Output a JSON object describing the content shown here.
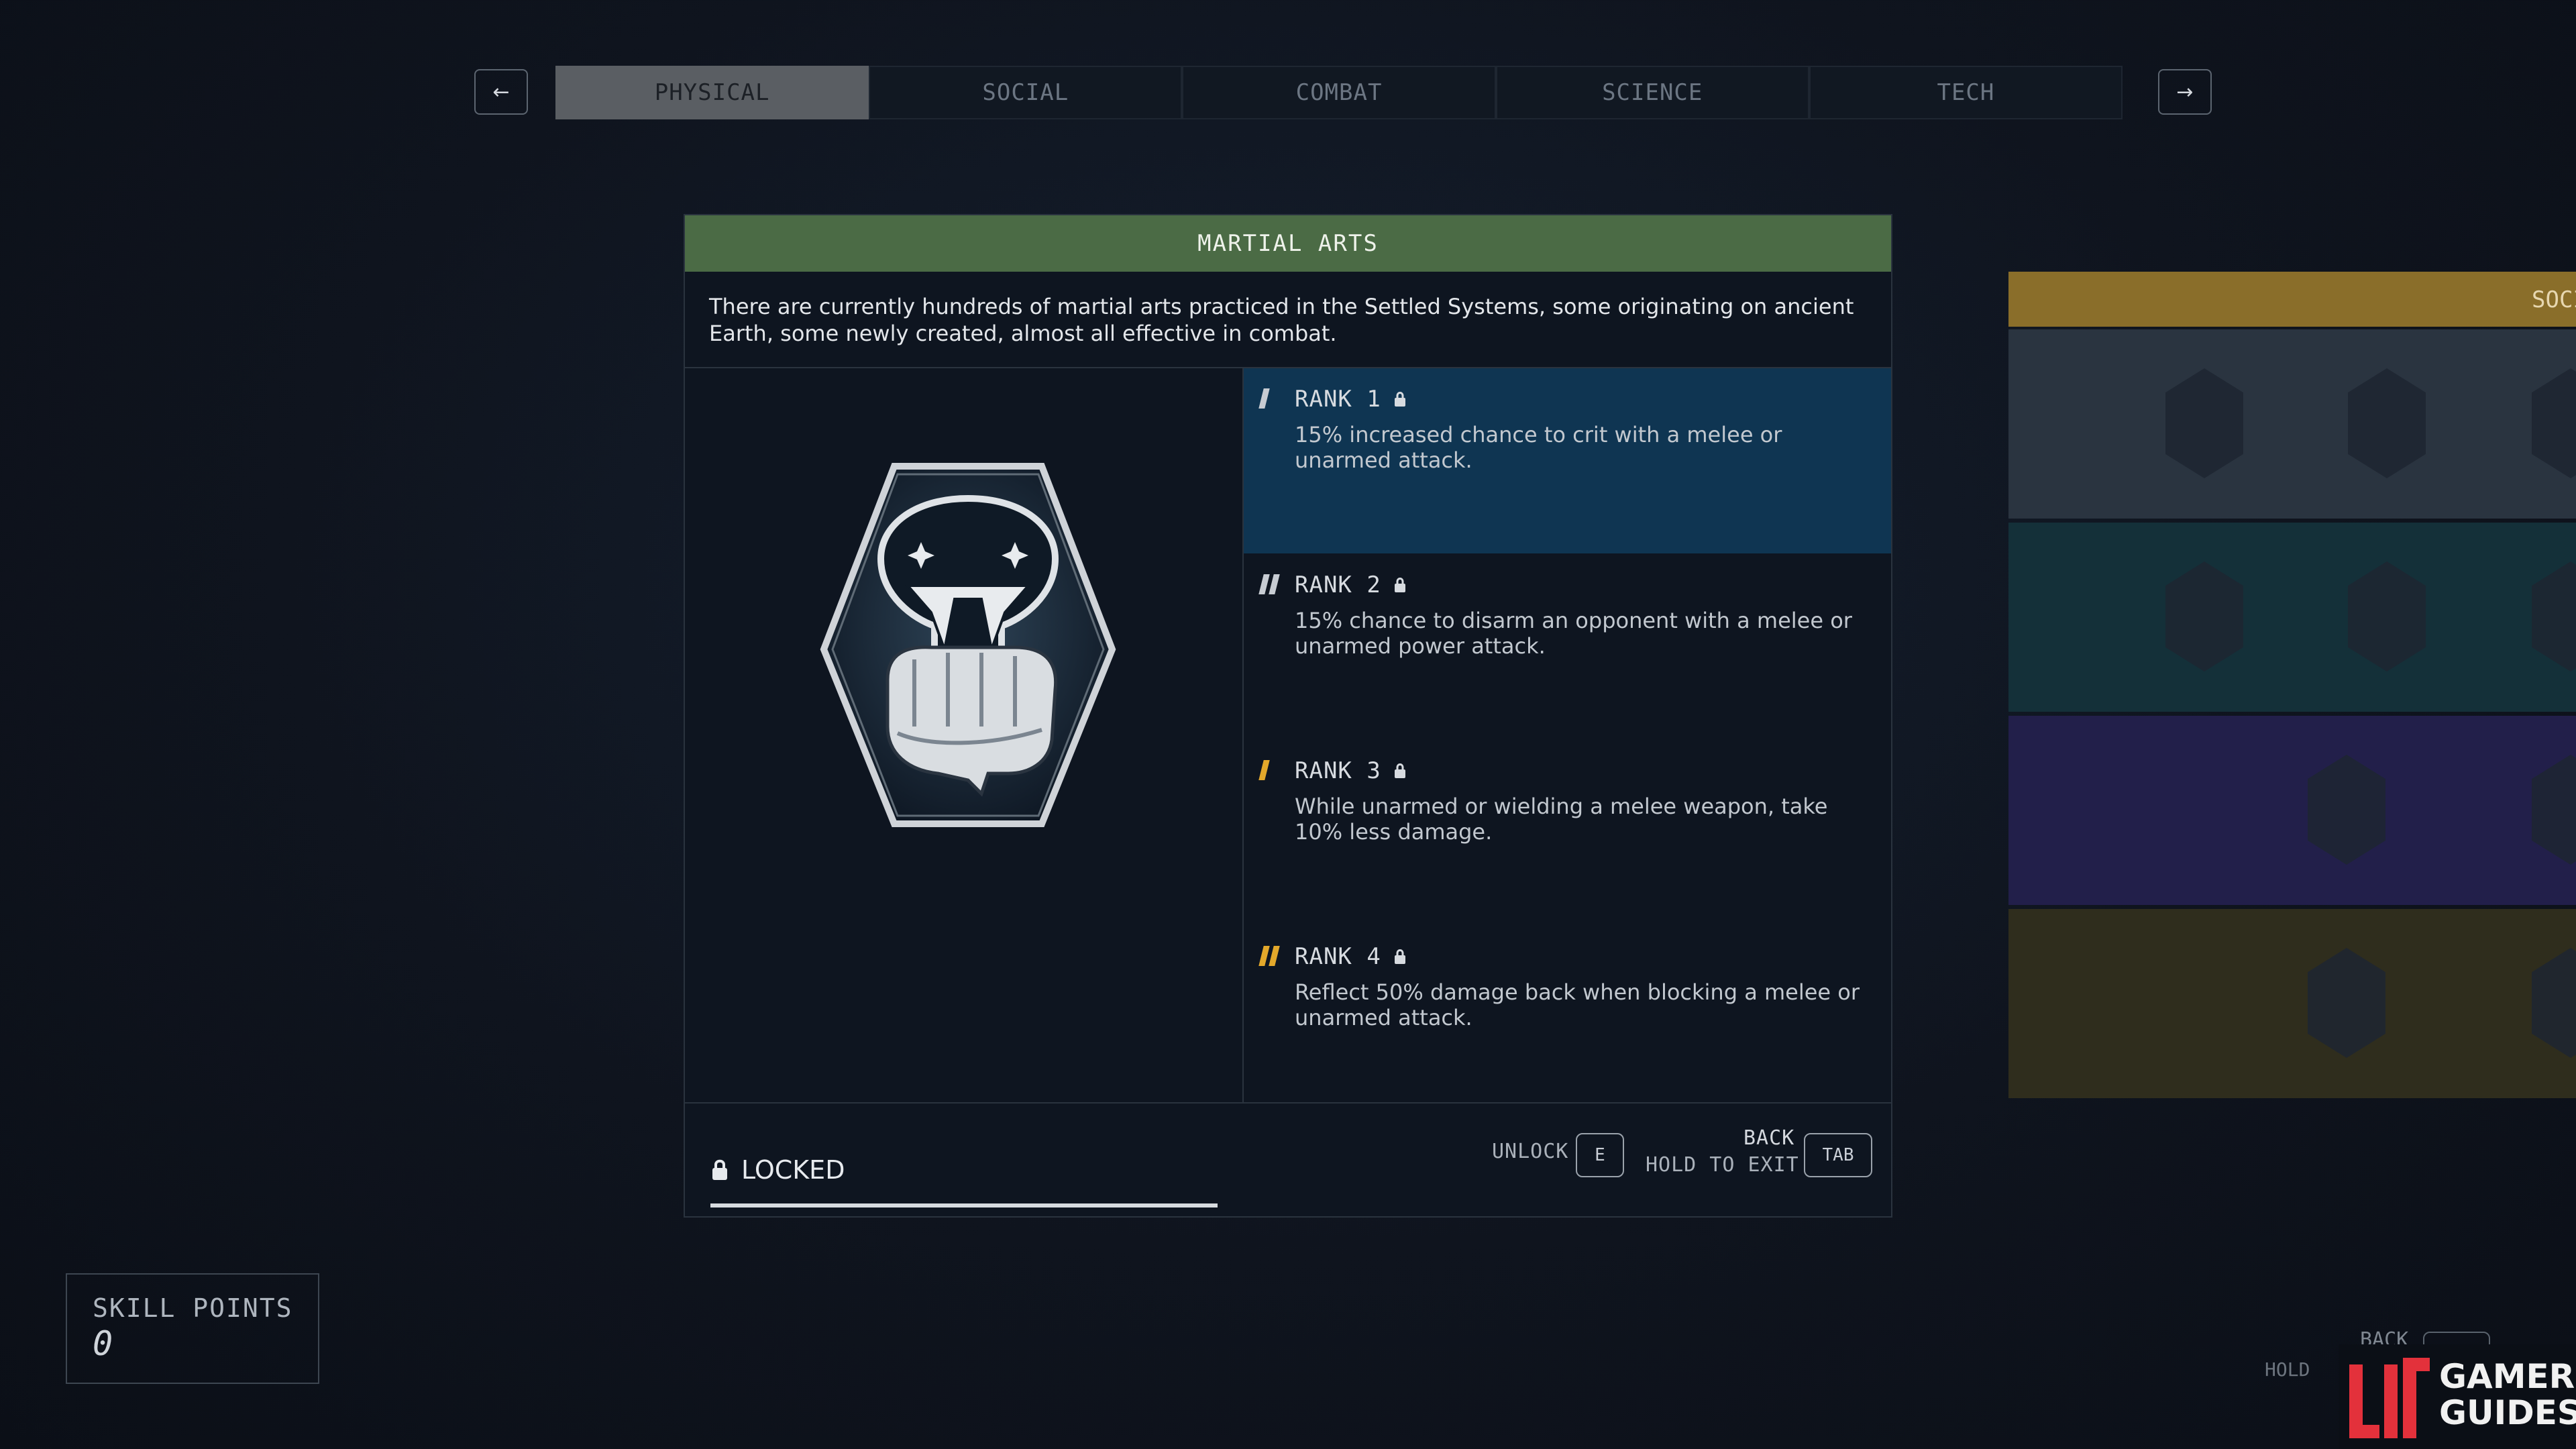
{
  "nav": {
    "prev_icon": "arrow-left-icon",
    "prev_glyph": "←",
    "next_icon": "arrow-right-icon",
    "next_glyph": "→",
    "tabs": [
      {
        "label": "PHYSICAL",
        "active": true
      },
      {
        "label": "SOCIAL",
        "active": false
      },
      {
        "label": "COMBAT",
        "active": false
      },
      {
        "label": "SCIENCE",
        "active": false
      },
      {
        "label": "TECH",
        "active": false
      }
    ]
  },
  "skill": {
    "title": "MARTIAL ARTS",
    "description": "There are currently hundreds of martial arts practiced in the Settled Systems, some originating on ancient Earth, some newly created, almost all effective in combat.",
    "badge_icon": "snake-fist-badge-icon",
    "status": "LOCKED",
    "ranks": [
      {
        "label": "RANK 1",
        "text": "15% increased chance to crit with a melee or unarmed attack.",
        "marks": 1,
        "selected": true
      },
      {
        "label": "RANK 2",
        "text": "15% chance to disarm an opponent with a melee or unarmed power attack.",
        "marks": 2,
        "selected": false
      },
      {
        "label": "RANK 3",
        "text": "While unarmed or wielding a melee weapon, take 10% less damage.",
        "marks": 1,
        "selected": false
      },
      {
        "label": "RANK 4",
        "text": "Reflect 50% damage back when blocking a melee or unarmed attack.",
        "marks": 2,
        "selected": false
      }
    ]
  },
  "footer": {
    "unlock_label": "UNLOCK",
    "unlock_key": "E",
    "back_label": "BACK",
    "hold_label": "HOLD TO EXIT",
    "back_key": "TAB"
  },
  "side_panel": {
    "header": "SOCI",
    "colors": [
      "#2a3440",
      "#143039",
      "#221f4a",
      "#2f2d1d"
    ]
  },
  "skill_points": {
    "label": "SKILL POINTS",
    "value": "0"
  },
  "watermark": {
    "back": "BACK",
    "hold": "HOLD",
    "brand_line1": "GAMER",
    "brand_line2": "GUIDES"
  },
  "colors": {
    "accent_green": "#4b6b45",
    "selected_blue": "#0f3552",
    "rank_gold": "#e3a82b"
  }
}
